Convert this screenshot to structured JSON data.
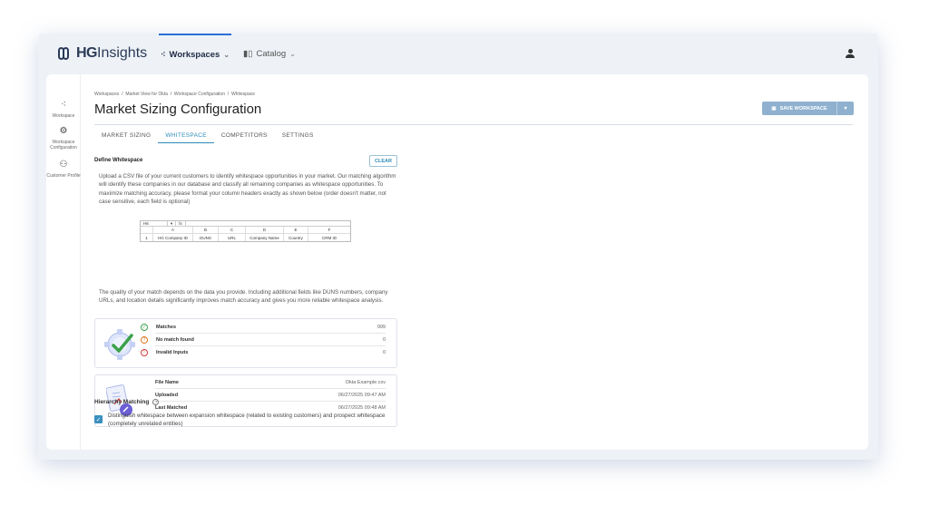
{
  "brand": {
    "bold": "HG",
    "light": "Insights"
  },
  "nav": [
    {
      "label": "Workspaces",
      "icon": "workspaces-icon",
      "active": true
    },
    {
      "label": "Catalog",
      "icon": "catalog-icon",
      "active": false
    }
  ],
  "sidebar": {
    "items": [
      {
        "label": "Workspace"
      },
      {
        "label": "Workspace Configuration"
      },
      {
        "label": "Customer Profile"
      }
    ]
  },
  "breadcrumb": [
    "Workspaces",
    "Market View for Okta",
    "Workspace Configuration",
    "Whitespace"
  ],
  "page_title": "Market Sizing Configuration",
  "save_button": "SAVE WORKSPACE",
  "tabs": [
    "MARKET SIZING",
    "WHITESPACE",
    "COMPETITORS",
    "SETTINGS"
  ],
  "active_tab": "WHITESPACE",
  "section": {
    "title": "Define Whitespace",
    "clear": "CLEAR",
    "desc1": "Upload a CSV file of your current customers to identify whitespace opportunities in your market. Our matching algorithm will identify these companies in our database and classify all remaining companies as whitespace opportunities. To maximize matching accuracy, please format your column headers exactly as shown below (order doesn't matter, not case sensitive, each field is optional)",
    "desc2": "The quality of your match depends on the data you provide. Including additional fields like DUNS numbers, company URLs, and location details significantly improves match accuracy and gives you more reliable whitespace analysis."
  },
  "sheet": {
    "cell_ref": "H6",
    "fx": "fx",
    "columns": [
      "A",
      "B",
      "C",
      "D",
      "E",
      "F"
    ],
    "row_num": "1",
    "headers": [
      "HG Company ID",
      "DUNS",
      "URL",
      "Company Name",
      "Country",
      "CRM ID"
    ]
  },
  "match_stats": [
    {
      "label": "Matches",
      "value": "999",
      "status": "success",
      "color": "#3aa14a"
    },
    {
      "label": "No match found",
      "value": "0",
      "status": "warning",
      "color": "#e07a1f"
    },
    {
      "label": "Invalid Inputs",
      "value": "0",
      "status": "error",
      "color": "#d23b3b"
    }
  ],
  "file_info": [
    {
      "label": "File Name",
      "value": "Okta Example.csv"
    },
    {
      "label": "Uploaded",
      "value": "06/27/2025 09:47 AM"
    },
    {
      "label": "Last Matched",
      "value": "06/27/2025 09:48 AM"
    }
  ],
  "hierarchy": {
    "title": "Hierarchy Matching",
    "checked": true,
    "checkbox_label": "Distinguish whitespace between expansion whitespace (related to existing customers) and prospect whitespace (completely unrelated entities)"
  },
  "colors": {
    "accent": "#2f8bb7",
    "save_button": "#8fb1cf",
    "nav_active": "#2b6fd6"
  }
}
